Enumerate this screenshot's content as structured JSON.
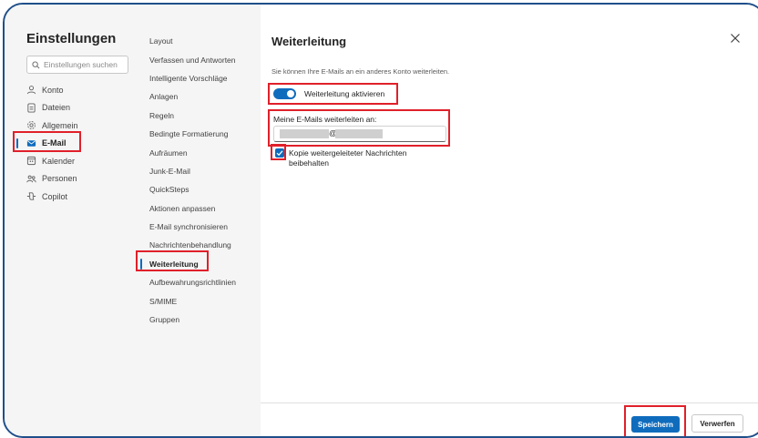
{
  "app": {
    "title": "Einstellungen"
  },
  "search": {
    "placeholder": "Einstellungen suchen"
  },
  "sidebar": {
    "items": [
      {
        "label": "Konto",
        "icon": "person-icon"
      },
      {
        "label": "Dateien",
        "icon": "file-icon"
      },
      {
        "label": "Allgemein",
        "icon": "gear-icon"
      },
      {
        "label": "E-Mail",
        "icon": "mail-icon",
        "selected": true
      },
      {
        "label": "Kalender",
        "icon": "calendar-icon"
      },
      {
        "label": "Personen",
        "icon": "people-icon"
      },
      {
        "label": "Copilot",
        "icon": "copilot-icon"
      }
    ]
  },
  "subnav": {
    "items": [
      {
        "label": "Layout"
      },
      {
        "label": "Verfassen und Antworten"
      },
      {
        "label": "Intelligente Vorschläge"
      },
      {
        "label": "Anlagen"
      },
      {
        "label": "Regeln"
      },
      {
        "label": "Bedingte Formatierung"
      },
      {
        "label": "Aufräumen"
      },
      {
        "label": "Junk-E-Mail"
      },
      {
        "label": "QuickSteps"
      },
      {
        "label": "Aktionen anpassen"
      },
      {
        "label": "E-Mail synchronisieren"
      },
      {
        "label": "Nachrichtenbehandlung"
      },
      {
        "label": "Weiterleitung",
        "selected": true
      },
      {
        "label": "Aufbewahrungsrichtlinien"
      },
      {
        "label": "S/MIME"
      },
      {
        "label": "Gruppen"
      }
    ]
  },
  "panel": {
    "title": "Weiterleitung",
    "description": "Sie können Ihre E-Mails an ein anderes Konto weiterleiten.",
    "toggle": {
      "label": "Weiterleitung aktivieren",
      "on": true
    },
    "forward_label": "Meine E-Mails weiterleiten an:",
    "email_at": "@",
    "keep_copy": {
      "label": "Kopie weitergeleiteter Nachrichten beibehalten",
      "checked": true
    },
    "save_label": "Speichern",
    "discard_label": "Verwerfen"
  },
  "colors": {
    "accent": "#0f6cbd",
    "highlight_box": "#e0202a",
    "frame_border": "#1f4f8a",
    "sidebar_bg": "#f5f5f5"
  }
}
